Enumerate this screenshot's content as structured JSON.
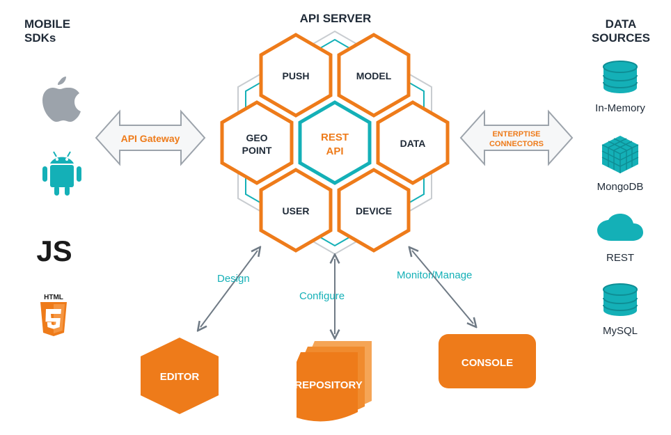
{
  "headers": {
    "sdks": "MOBILE SDKs",
    "api": "API SERVER",
    "sources": "DATA SOURCES"
  },
  "gateway": "API Gateway",
  "connectors": "ENTERPTISE CONNECTORS",
  "hex": {
    "push": "PUSH",
    "model": "MODEL",
    "geo1": "GEO",
    "geo2": "POINT",
    "rest1": "REST",
    "rest2": "API",
    "data": "DATA",
    "user": "USER",
    "device": "DEVICE"
  },
  "actions": {
    "design": "Design",
    "configure": "Configure",
    "monitor": "Monitor/Manage"
  },
  "tools": {
    "editor": "EDITOR",
    "repo": "REPOSITORY",
    "console": "CONSOLE"
  },
  "sdks": {
    "js": "JS",
    "html": "HTML"
  },
  "sources": {
    "mem": "In-Memory",
    "mongo": "MongoDB",
    "rest": "REST",
    "mysql": "MySQL"
  },
  "colors": {
    "orange": "#ee7b1a",
    "teal": "#14b0b7",
    "grey": "#6f7a85",
    "dark": "#1f2a37"
  }
}
